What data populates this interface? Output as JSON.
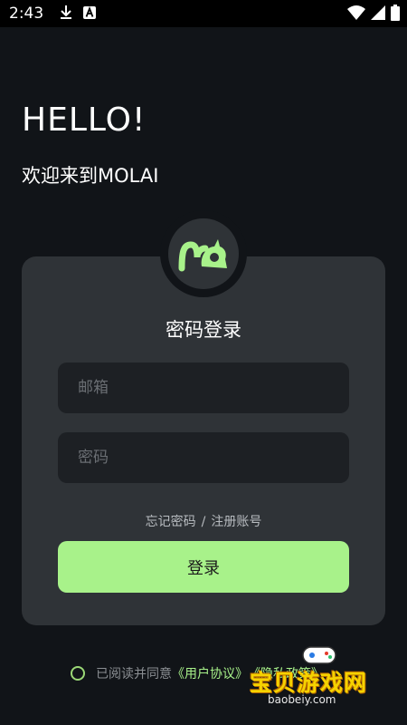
{
  "status_bar": {
    "time": "2:43",
    "icons_left": [
      "download-icon",
      "a-badge-icon"
    ],
    "icons_right": [
      "wifi-icon",
      "signal-icon",
      "battery-icon"
    ]
  },
  "header": {
    "greeting": "HELLO!",
    "welcome": "欢迎来到MOLAI"
  },
  "logo": {
    "icon": "molai-logo-icon",
    "accent": "#a8f28a"
  },
  "login": {
    "title": "密码登录",
    "email_placeholder": "邮箱",
    "password_placeholder": "密码",
    "forgot_password": "忘记密码",
    "separator": "/",
    "register": "注册账号",
    "submit_label": "登录"
  },
  "agreement": {
    "prefix": "已阅读并同意",
    "user_agreement": "《用户协议》",
    "privacy_policy": "《隐私政策》"
  },
  "watermark": {
    "text": "宝贝游戏网",
    "url": "baobeiy.com"
  },
  "colors": {
    "background": "#111418",
    "card": "#2f3337",
    "input": "#1d2024",
    "accent": "#a8f28a"
  }
}
